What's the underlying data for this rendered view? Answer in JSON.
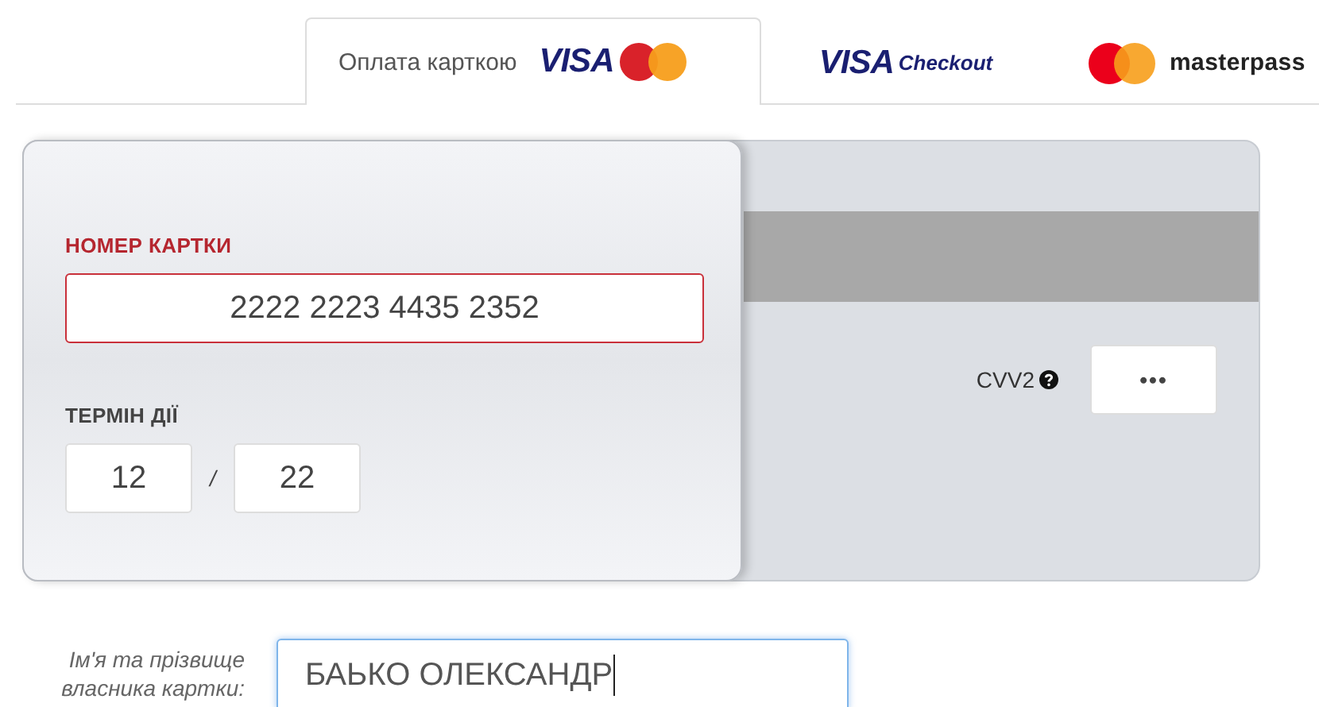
{
  "tabs": [
    {
      "label": "Оплата карткою",
      "selected": true,
      "logo": {
        "kind": "visa-mc",
        "text": "VISA"
      }
    },
    {
      "selected": false,
      "logo": {
        "kind": "visa-checkout",
        "text": "VISA",
        "subtext": "Checkout"
      }
    },
    {
      "selected": false,
      "logo": {
        "kind": "masterpass",
        "text": "masterpass"
      }
    }
  ],
  "card_number": {
    "label": "НОМЕР КАРТКИ",
    "value": "2222 2223 4435 2352",
    "invalid": true
  },
  "expiry": {
    "label": "ТЕРМІН ДІЇ",
    "month": "12",
    "separator": "/",
    "year": "22"
  },
  "cvv": {
    "label": "CVV2",
    "value": "•••"
  },
  "holder": {
    "label": "Ім'я та прізвище власника картки:",
    "value": "БАЬКО ОЛЕКСАНДР",
    "focused": true
  }
}
